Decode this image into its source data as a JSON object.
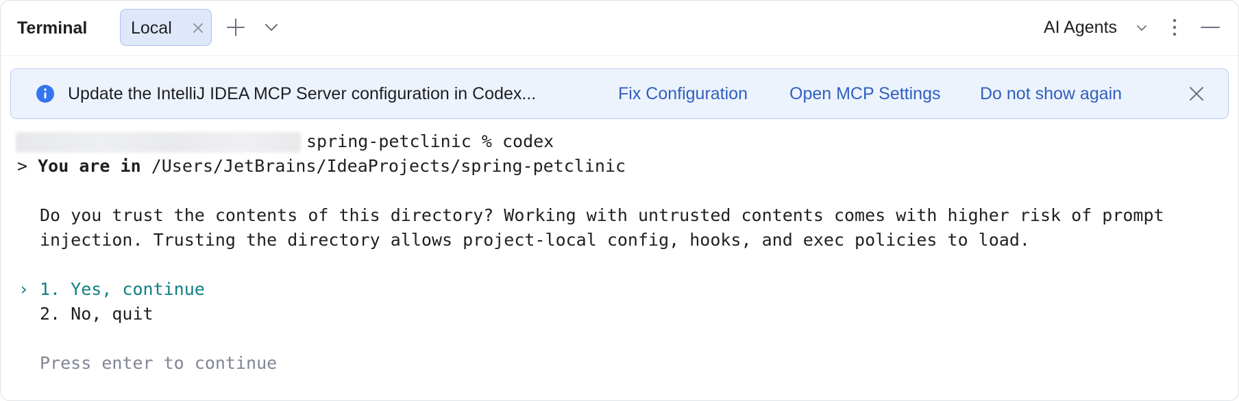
{
  "header": {
    "title": "Terminal",
    "tab_label": "Local",
    "agents_label": "AI Agents"
  },
  "icons": {
    "tab_close": "close-icon",
    "new_tab": "plus-icon",
    "tab_menu": "chevron-down-icon",
    "agents_menu": "chevron-down-icon",
    "options": "more-vertical-icon",
    "hide": "minimize-icon",
    "banner_info": "info-icon",
    "banner_close": "close-icon"
  },
  "banner": {
    "message": "Update the IntelliJ IDEA MCP Server configuration in Codex...",
    "fix_label": "Fix Configuration",
    "settings_label": "Open MCP Settings",
    "dismiss_label": "Do not show again"
  },
  "terminal": {
    "prompt_command": "spring-petclinic % codex",
    "location_marker": ">",
    "location_label": "You are in",
    "location_path": "/Users/JetBrains/IdeaProjects/spring-petclinic",
    "question_line1": "Do you trust the contents of this directory? Working with untrusted contents comes with higher risk of prompt",
    "question_line2": "injection. Trusting the directory allows project-local config, hooks, and exec policies to load.",
    "selection_marker": "›",
    "option1": "1. Yes, continue",
    "option2": "2. No, quit",
    "hint": "Press enter to continue"
  },
  "colors": {
    "accent_link": "#2f5fbf",
    "selected_option": "#0f7f82",
    "banner_background": "#edf3fd",
    "tab_background": "#dfe8fb"
  }
}
